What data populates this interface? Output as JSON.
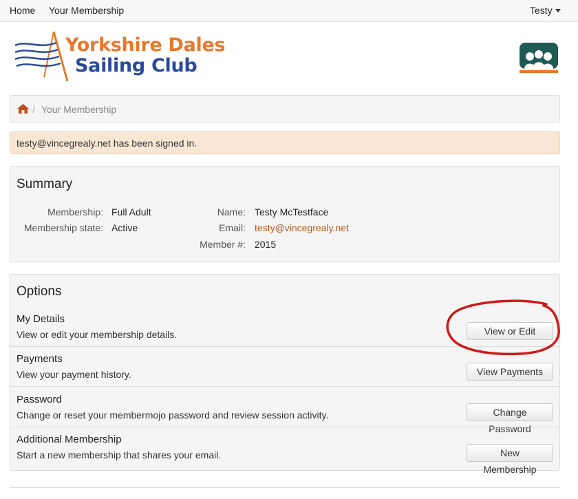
{
  "nav": {
    "home": "Home",
    "membership": "Your Membership",
    "user": "Testy"
  },
  "logo": {
    "line1": "Yorkshire Dales",
    "line2": "Sailing Club"
  },
  "breadcrumb": {
    "home_icon": "home-icon",
    "separator": "/",
    "current": "Your Membership"
  },
  "alert": {
    "text": "testy@vincegrealy.net has been signed in."
  },
  "summary": {
    "title": "Summary",
    "membership_label": "Membership:",
    "membership_value": "Full Adult",
    "state_label": "Membership state:",
    "state_value": "Active",
    "name_label": "Name:",
    "name_value": "Testy McTestface",
    "email_label": "Email:",
    "email_value": "testy@vincegrealy.net",
    "member_no_label": "Member #:",
    "member_no_value": "2015"
  },
  "options": {
    "title": "Options",
    "items": [
      {
        "title": "My Details",
        "desc": "View or edit your membership details.",
        "button": "View or Edit"
      },
      {
        "title": "Payments",
        "desc": "View your payment history.",
        "button": "View Payments"
      },
      {
        "title": "Password",
        "desc": "Change or reset your membermojo password and review session activity.",
        "button": "Change Password"
      },
      {
        "title": "Additional Membership",
        "desc": "Start a new membership that shares your email.",
        "button": "New Membership"
      }
    ]
  },
  "colors": {
    "logo_orange": "#e8782b",
    "logo_blue": "#2a4a9a",
    "link": "#b05a1c",
    "alert_bg": "#f9e6d4",
    "annotation": "#d01a1a"
  }
}
